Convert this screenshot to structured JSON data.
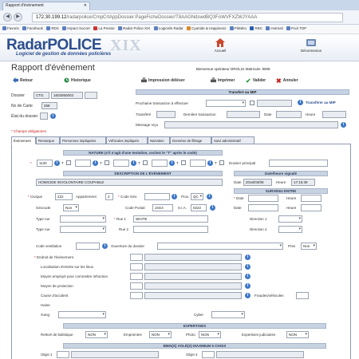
{
  "browser": {
    "tab_title": "Rapport d'évènement",
    "url_host": "172.30.199.12",
    "url_path": "/radarpolice/CmpCrtAppDossier.PageFicheDossier/T8AAGNdswdBQ3FoWVFXZWJYAAA",
    "bookmarks": [
      "Favoris",
      "Facebook",
      "RDS",
      "Impact Soccer",
      "La Presse",
      "Radar Police XIX",
      "Logiciels Radar",
      "Cyanide & Happiness",
      "PikNiko",
      "RBC",
      "Hotmail",
      "Pool TDP"
    ]
  },
  "header": {
    "logo_main": "RadarPOLICE",
    "logo_version": "XIX",
    "logo_sub": "Logiciel de gestion de données policières",
    "accueil": "Accueil",
    "deconnexion": "Déconnexion"
  },
  "page": {
    "title": "Rapport d'évènement",
    "operator": "Bienvenue opérateur DROL31 Matricule: 9008"
  },
  "actions": {
    "retour": "Retour",
    "historique": "Historique",
    "impression": "Impression déléser",
    "imprimer": "Imprimer",
    "valider": "Valider",
    "annuler": "Annuler"
  },
  "dossier": {
    "dossier_label": "Dossier",
    "dossier_prefix": "CTG",
    "dossier_number": "1603050003",
    "no_carte_label": "No de Carte",
    "no_carte_value": "258",
    "etat_label": "État du dossier"
  },
  "mip": {
    "header": "Transfert au MIP",
    "prochaine_label": "Prochaine transaction à effectuer",
    "transferer_label": "Transférer au MIP",
    "transfere_label": "Transféré",
    "derniere_label": "Dernière transaction",
    "date_label": "Date",
    "heure_label": "Heure",
    "message_label": "Message reçu"
  },
  "required_note": "* Champs obligatoires",
  "tabs": [
    "Évènement",
    "Remarque",
    "Personnes impliquées",
    "Véhicules impliqués",
    "Narration",
    "Données de filtrage",
    "Suivi administratif"
  ],
  "nature": {
    "header": "NATURE (s'il s'agit d'une tentative, cochez le \"T\" après le code)",
    "code1": "1130",
    "t_label": "T",
    "dossier_principal_label": "Dossier principal"
  },
  "description": {
    "header": "DESCRIPTION DE L'ÉVÈNEMENT",
    "value": "HOMICIDE INVOLONTAIRE COUPABLE",
    "date_signale_header": "Date/heure signalé",
    "date_label": "Date",
    "date_value": "2016/03/08",
    "heure_label": "Heure",
    "heure_value": "17:16:39",
    "survenu_header": "SURVENU ENTRE"
  },
  "address": {
    "civique_label": "Civique",
    "civique_value": "222",
    "appartement_label": "Appartement",
    "appartement_value": "2",
    "code_geo_label": "Code Géo",
    "prov_label": "Prov.",
    "prov_value": "QC",
    "geocode_label": "Géocode",
    "geocode_value": "Non",
    "code_postal_label": "Code Postal",
    "code_postal_value": "J4G4",
    "sia_label": "S.I.A.",
    "sia_value": "0222",
    "type_rue_label": "Type rue",
    "rue1_label": "Rue 1",
    "rue1_value": "WHITE",
    "rue2_label": "Rue 2",
    "direction1_label": "Direction 1",
    "direction2_label": "Direction 2",
    "date_label": "Date",
    "heure_label": "Heure"
  },
  "details": {
    "code_ventilation_label": "Code ventilation",
    "ouverture_label": "Ouverture du dossier",
    "pres_label": "Pres",
    "pres_value": "Non",
    "endroit_label": "Endroit de l'évènement",
    "localisation_label": "Localisation d'entrée sur les lieux",
    "moyen_employe_label": "Moyen employé pour commettre infraction",
    "moyen_protection_label": "Moyen de protection",
    "cause_label": "Cause d'accident",
    "fraudes_label": "Fraudes/véhicules",
    "haine_label": "Haine",
    "gang_label": "Gang",
    "cyber_label": "Cyber"
  },
  "expertises": {
    "header": "EXPERTISES",
    "releve_label": "Relevé de balistique",
    "releve_value": "NON",
    "empreintes_label": "Empreintes",
    "empreintes_value": "NON",
    "photo_label": "Photo",
    "photo_value": "NON",
    "judiciaires_label": "Expertises judiciaires",
    "judiciaires_value": "NON"
  },
  "biens": {
    "header": "BIEN(S) VOLÉ(S) MAXIMUM 5 CHOIX",
    "objet1_label": "Objet 1",
    "objet4_label": "Objet 4"
  }
}
